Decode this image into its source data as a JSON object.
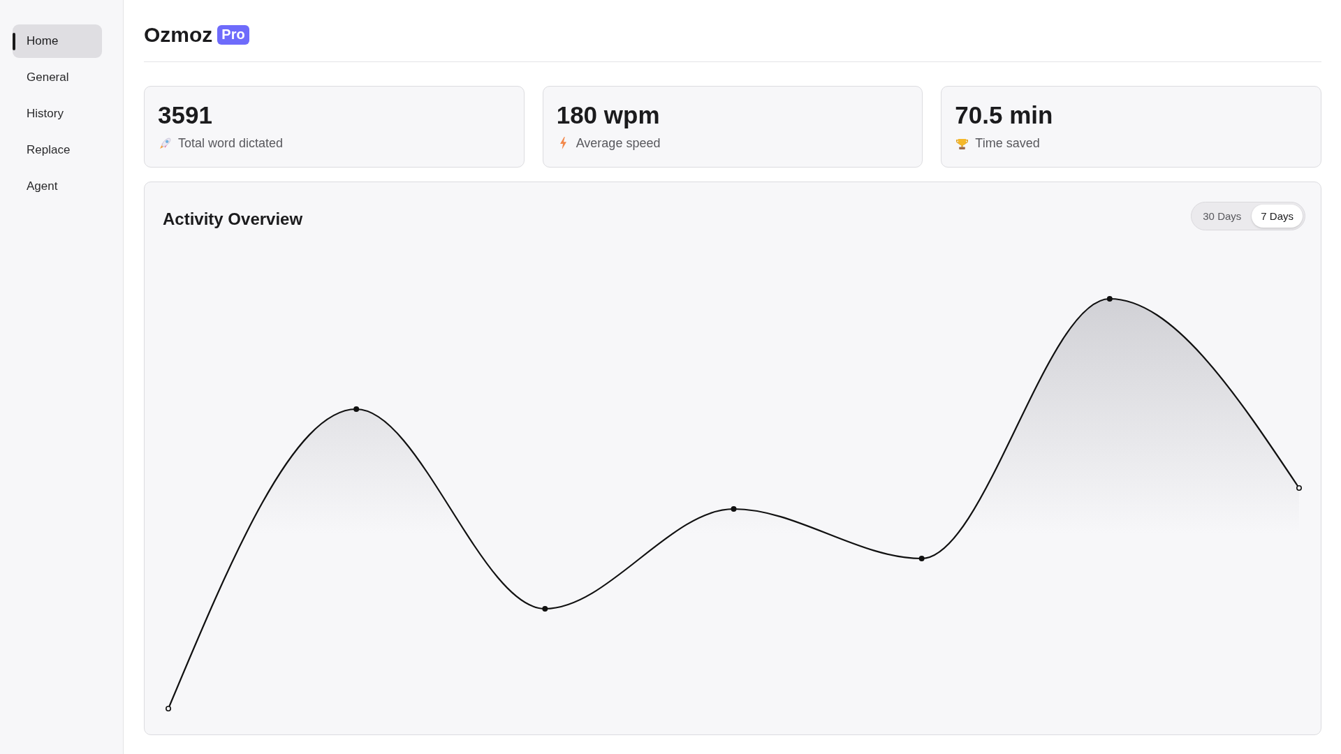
{
  "sidebar": {
    "items": [
      {
        "label": "Home",
        "selected": true
      },
      {
        "label": "General",
        "selected": false
      },
      {
        "label": "History",
        "selected": false
      },
      {
        "label": "Replace",
        "selected": false
      },
      {
        "label": "Agent",
        "selected": false
      }
    ]
  },
  "header": {
    "title": "Ozmoz",
    "badge": "Pro"
  },
  "stats": [
    {
      "value": "3591",
      "label": "Total word dictated"
    },
    {
      "value": "180 wpm",
      "label": "Average speed"
    },
    {
      "value": "70.5 min",
      "label": "Time saved"
    }
  ],
  "activity": {
    "title": "Activity Overview",
    "ranges": [
      {
        "label": "30 Days",
        "selected": false
      },
      {
        "label": "7 Days",
        "selected": true
      }
    ]
  }
}
